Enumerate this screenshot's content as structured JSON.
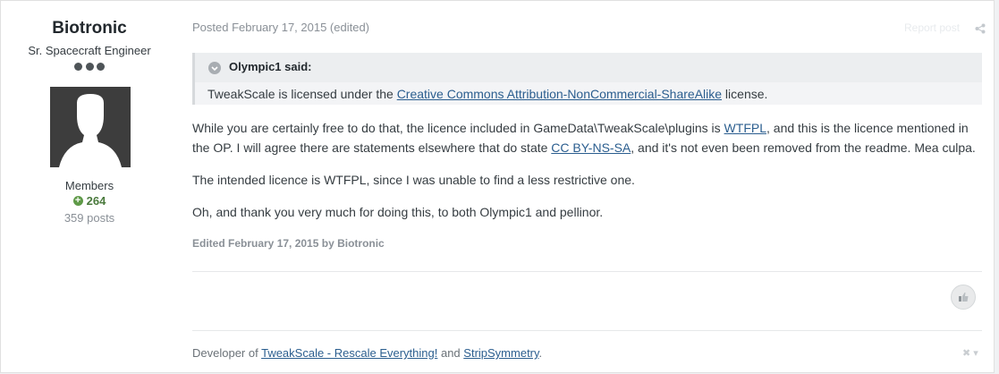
{
  "author": {
    "name": "Biotronic",
    "title": "Sr. Spacecraft Engineer",
    "group": "Members",
    "reputation": "264",
    "posts": "359 posts"
  },
  "post": {
    "meta": "Posted February 17, 2015 (edited)",
    "report_label": "Report post",
    "quote": {
      "author": "Olympic1 said:",
      "text_before": "TweakScale is licensed under the ",
      "link_text": "Creative Commons Attribution-NonCommercial-ShareAlike",
      "text_after": " license."
    },
    "paragraph1": {
      "a": "While you are certainly free to do that, the licence included in GameData\\TweakScale\\plugins is ",
      "link1": "WTFPL",
      "b": ", and this is the licence mentioned in the OP. I will agree there are statements elsewhere that do state ",
      "link2": "CC BY-NS-SA",
      "c": ", and it's not even been removed from the readme. Mea culpa."
    },
    "paragraph2": "The intended licence is WTFPL, since I was unable to find a less restrictive one.",
    "paragraph3": "Oh, and thank you very much for doing this, to both Olympic1 and pellinor.",
    "edited": "Edited February 17, 2015 by Biotronic"
  },
  "signature": {
    "prefix": "Developer of ",
    "link1": "TweakScale - Rescale Everything!",
    "middle": " and ",
    "link2": "StripSymmetry",
    "suffix": "."
  },
  "icons": {
    "share": "share-icon",
    "like": "like-icon",
    "quote_toggle": "chevron-down-icon",
    "rep": "plus-circle-icon"
  },
  "colors": {
    "link": "#2b5e8f",
    "reputation": "#4a7a3d",
    "muted": "#8a9097"
  }
}
